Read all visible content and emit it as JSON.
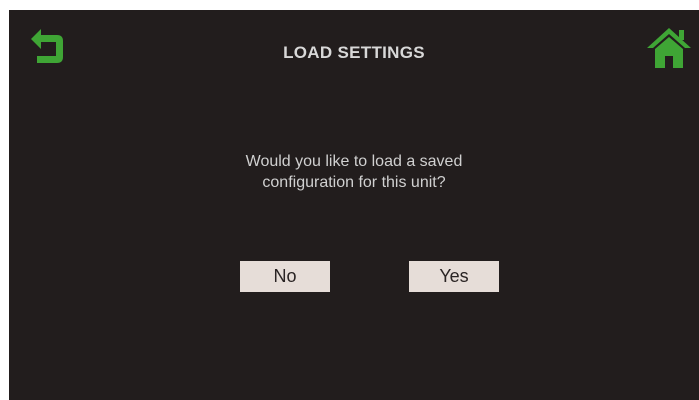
{
  "header": {
    "title": "LOAD SETTINGS",
    "back_icon": "back-arrow-icon",
    "home_icon": "home-icon"
  },
  "dialog": {
    "message_line1": "Would you like to load a saved",
    "message_line2": "configuration for this unit?",
    "no_label": "No",
    "yes_label": "Yes"
  },
  "colors": {
    "background": "#221d1d",
    "accent_green": "#3fa535",
    "button_bg": "#e6ddd8",
    "text": "#d0d0d0"
  }
}
